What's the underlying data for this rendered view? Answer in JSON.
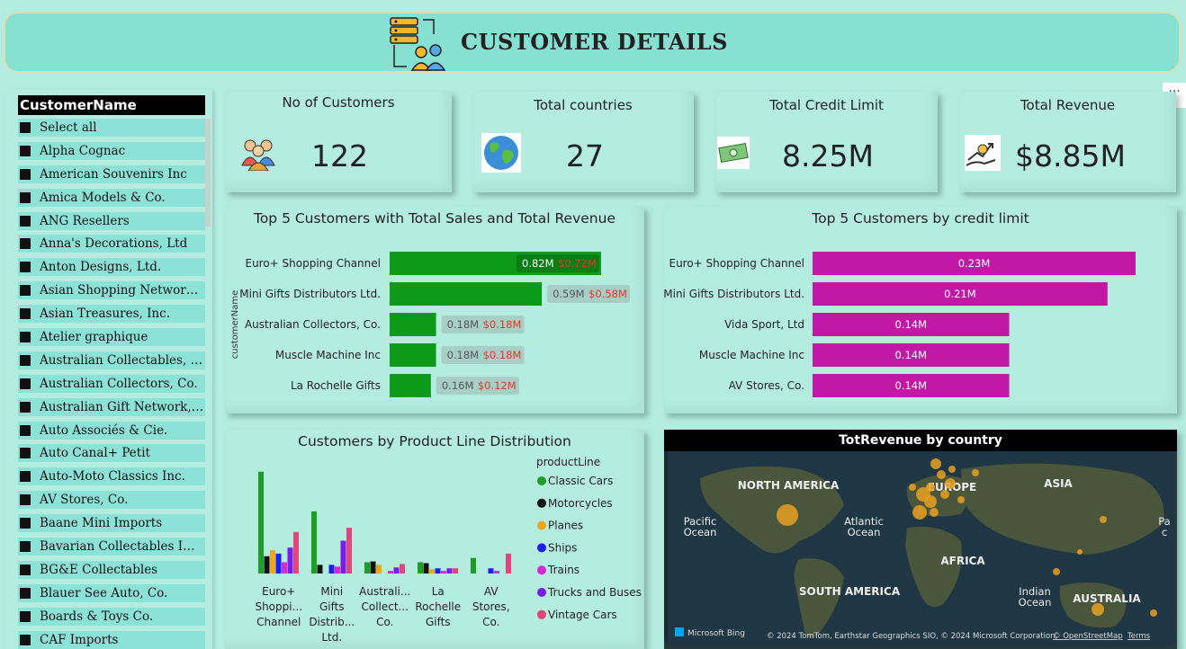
{
  "header": {
    "title": "CUSTOMER DETAILS"
  },
  "slicer": {
    "title": "CustomerName",
    "items": [
      "Select all",
      "Alpha Cognac",
      "American Souvenirs Inc",
      "Amica Models & Co.",
      "ANG Resellers",
      "Anna's Decorations, Ltd",
      "Anton Designs, Ltd.",
      "Asian Shopping Network, Co",
      "Asian Treasures, Inc.",
      "Atelier graphique",
      "Australian Collectables, Ltd",
      "Australian Collectors, Co.",
      "Australian Gift Network, Co",
      "Auto Associés & Cie.",
      "Auto Canal+ Petit",
      "Auto-Moto Classics Inc.",
      "AV Stores, Co.",
      "Baane Mini Imports",
      "Bavarian Collectables Impor...",
      "BG&E Collectables",
      "Blauer See Auto, Co.",
      "Boards & Toys Co.",
      "CAF Imports"
    ]
  },
  "kpis": [
    {
      "title": "No of Customers",
      "value": "122",
      "icon": "people-icon"
    },
    {
      "title": "Total countries",
      "value": "27",
      "icon": "globe-icon"
    },
    {
      "title": "Total Credit Limit",
      "value": "8.25M",
      "icon": "money-icon"
    },
    {
      "title": "Total Revenue",
      "value": "$8.85M",
      "icon": "revenue-icon"
    }
  ],
  "colors": {
    "green": "#0d9a1a",
    "magenta": "#c118a5",
    "red_label": "#e8352a"
  },
  "chart_data": [
    {
      "type": "bar",
      "title": "Top 5 Customers with Total Sales and Total Revenue",
      "ylabel": "customerName",
      "categories": [
        "Euro+ Shopping Channel",
        "Mini Gifts Distributors Ltd.",
        "Australian Collectors, Co.",
        "Muscle Machine Inc",
        "La Rochelle Gifts"
      ],
      "series": [
        {
          "values": [
            0.82,
            0.59,
            0.18,
            0.18,
            0.16
          ],
          "labels": [
            "0.82M",
            "0.59M",
            "0.18M",
            "0.18M",
            "0.16M"
          ]
        },
        {
          "values": [
            0.72,
            0.58,
            0.18,
            0.18,
            0.12
          ],
          "labels": [
            "$0.72M",
            "$0.58M",
            "$0.18M",
            "$0.18M",
            "$0.12M"
          ]
        }
      ],
      "orientation": "horizontal",
      "xlim": [
        0,
        1.2
      ]
    },
    {
      "type": "bar",
      "title": "Top 5 Customers by credit limit",
      "categories": [
        "Euro+ Shopping Channel",
        "Mini Gifts Distributors Ltd.",
        "Vida Sport, Ltd",
        "Muscle Machine Inc",
        "AV Stores, Co."
      ],
      "values": [
        0.23,
        0.21,
        0.14,
        0.14,
        0.14
      ],
      "labels": [
        "0.23M",
        "0.21M",
        "0.14M",
        "0.14M",
        "0.14M"
      ],
      "orientation": "horizontal",
      "xlim": [
        0,
        0.25
      ]
    },
    {
      "type": "bar",
      "title": "Customers by Product Line Distribution",
      "legend_title": "productLine",
      "legend_position": "right",
      "categories": [
        "Euro+ Shoppi... Channel",
        "Mini Gifts Distrib... Ltd.",
        "Australi... Collect... Co.",
        "La Rochelle Gifts",
        "AV Stores, Co."
      ],
      "category_lines": [
        [
          "Euro+",
          "Shoppi...",
          "Channel"
        ],
        [
          "Mini",
          "Gifts",
          "Distrib...",
          "Ltd."
        ],
        [
          "Australi...",
          "Collect...",
          "Co."
        ],
        [
          "La",
          "Rochelle",
          "Gifts"
        ],
        [
          "AV",
          "Stores,",
          "Co."
        ]
      ],
      "series": [
        {
          "name": "Classic Cars",
          "color": "#1e9e26",
          "values": [
            118,
            72,
            13,
            13,
            18
          ]
        },
        {
          "name": "Motorcycles",
          "color": "#111111",
          "values": [
            20,
            10,
            14,
            12,
            0
          ]
        },
        {
          "name": "Planes",
          "color": "#f2a61c",
          "values": [
            27,
            0,
            10,
            5,
            0
          ]
        },
        {
          "name": "Ships",
          "color": "#1b1ff0",
          "values": [
            23,
            10,
            0,
            6,
            6
          ]
        },
        {
          "name": "Trains",
          "color": "#d629d6",
          "values": [
            13,
            8,
            3,
            3,
            3
          ]
        },
        {
          "name": "Trucks and Buses",
          "color": "#7b1de8",
          "values": [
            30,
            38,
            7,
            6,
            0
          ]
        },
        {
          "name": "Vintage Cars",
          "color": "#e0467a",
          "values": [
            48,
            53,
            11,
            6,
            23
          ]
        }
      ],
      "ylim": [
        0,
        125
      ]
    }
  ],
  "map": {
    "title": "TotRevenue by country",
    "labels": [
      "NORTH AMERICA",
      "EUROPE",
      "ASIA",
      "Pacific",
      "Ocean",
      "Atlantic",
      "Ocean",
      "AFRICA",
      "SOUTH AMERICA",
      "Indian",
      "Ocean",
      "AUSTRALIA",
      "Pa",
      "c"
    ],
    "attribution": "© 2024 TomTom, Earthstar Geographics SIO, © 2024 Microsoft Corporation,",
    "osm": "© OpenStreetMap",
    "terms": "Terms",
    "bing": "Microsoft Bing"
  },
  "more_menu": "···"
}
